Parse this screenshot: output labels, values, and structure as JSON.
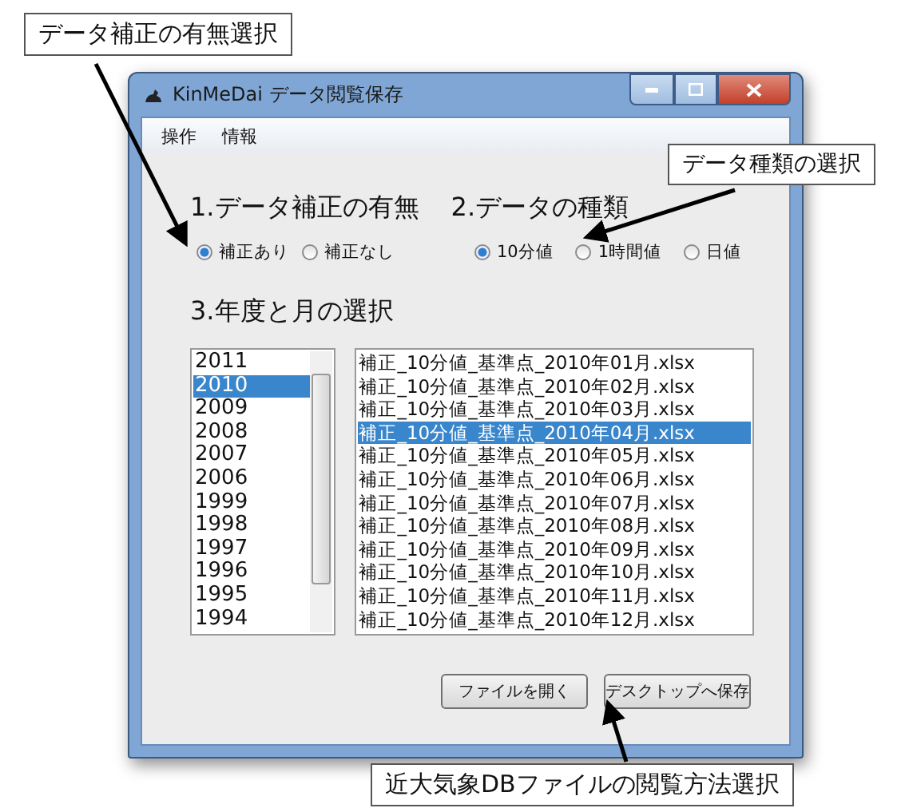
{
  "annotations": [
    {
      "text": "データ補正の有無選択"
    },
    {
      "text": "データ種類の選択"
    },
    {
      "text": "近大気象DBファイルの閲覧方法選択"
    }
  ],
  "window": {
    "title": "KinMeDai データ閲覧保存"
  },
  "menu": [
    "操作",
    "情報"
  ],
  "correction": {
    "title": "1.データ補正の有無",
    "options": [
      {
        "label": "補正あり",
        "selected": true
      },
      {
        "label": "補正なし",
        "selected": false
      }
    ]
  },
  "data_type": {
    "title": "2.データの種類",
    "options": [
      {
        "label": "10分値",
        "selected": true
      },
      {
        "label": "1時間値",
        "selected": false
      },
      {
        "label": "日値",
        "selected": false
      }
    ]
  },
  "period": {
    "title": "3.年度と月の選択",
    "years": [
      {
        "label": "2011",
        "selected": false
      },
      {
        "label": "2010",
        "selected": true
      },
      {
        "label": "2009",
        "selected": false
      },
      {
        "label": "2008",
        "selected": false
      },
      {
        "label": "2007",
        "selected": false
      },
      {
        "label": "2006",
        "selected": false
      },
      {
        "label": "1999",
        "selected": false
      },
      {
        "label": "1998",
        "selected": false
      },
      {
        "label": "1997",
        "selected": false
      },
      {
        "label": "1996",
        "selected": false
      },
      {
        "label": "1995",
        "selected": false
      },
      {
        "label": "1994",
        "selected": false
      }
    ],
    "files": [
      {
        "label": "補正_10分値_基準点_2010年01月.xlsx",
        "selected": false
      },
      {
        "label": "補正_10分値_基準点_2010年02月.xlsx",
        "selected": false
      },
      {
        "label": "補正_10分値_基準点_2010年03月.xlsx",
        "selected": false
      },
      {
        "label": "補正_10分値_基準点_2010年04月.xlsx",
        "selected": true
      },
      {
        "label": "補正_10分値_基準点_2010年05月.xlsx",
        "selected": false
      },
      {
        "label": "補正_10分値_基準点_2010年06月.xlsx",
        "selected": false
      },
      {
        "label": "補正_10分値_基準点_2010年07月.xlsx",
        "selected": false
      },
      {
        "label": "補正_10分値_基準点_2010年08月.xlsx",
        "selected": false
      },
      {
        "label": "補正_10分値_基準点_2010年09月.xlsx",
        "selected": false
      },
      {
        "label": "補正_10分値_基準点_2010年10月.xlsx",
        "selected": false
      },
      {
        "label": "補正_10分値_基準点_2010年11月.xlsx",
        "selected": false
      },
      {
        "label": "補正_10分値_基準点_2010年12月.xlsx",
        "selected": false
      }
    ]
  },
  "buttons": [
    "ファイルを開く",
    "デスクトップへ保存"
  ]
}
